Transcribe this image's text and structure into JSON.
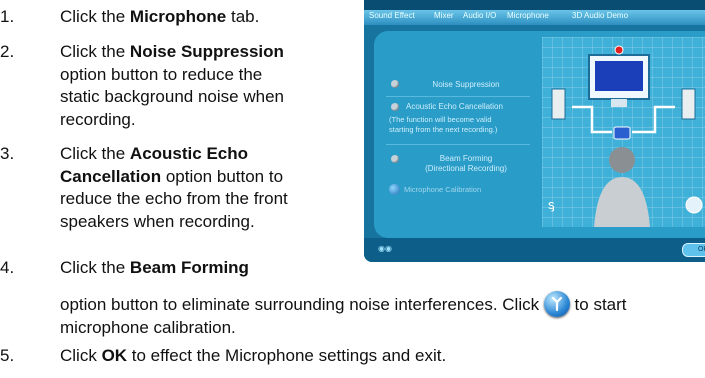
{
  "steps": [
    {
      "num": "1.",
      "pre": "Click the ",
      "bold": "Microphone",
      "post": " tab."
    },
    {
      "num": "2.",
      "pre": "Click the ",
      "bold": "Noise Suppression",
      "lines": [
        "option button to reduce the",
        "static background noise when",
        "recording."
      ]
    },
    {
      "num": "3.",
      "pre": "Click the ",
      "bold1": "Acoustic Echo",
      "bold2": "Cancellation",
      "post2": " option button to",
      "lines": [
        "reduce the echo from the front",
        "speakers when recording."
      ]
    },
    {
      "num": "4.",
      "pre": "Click the ",
      "bold": "Beam Forming",
      "line2_a": "option button to eliminate surrounding noise interferences. Click ",
      "line2_b": " to start",
      "line3": "microphone calibration."
    },
    {
      "num": "5.",
      "pre": "Click ",
      "bold": "OK",
      "post": " to effect the Microphone settings and exit."
    }
  ],
  "panel": {
    "tabs": [
      "Sound Effect",
      "Mixer",
      "Audio I/O",
      "Microphone",
      "3D Audio Demo"
    ],
    "options": {
      "noise": "Noise Suppression",
      "echo": "Acoustic Echo Cancellation",
      "echo_note_1": "(The function will become valid",
      "echo_note_2": "starting from the next recording.)",
      "beam_1": "Beam Forming",
      "beam_2": "(Directional Recording)",
      "calibration": "Microphone Calibration"
    },
    "ok_label": "OK"
  },
  "colors": {
    "panel_bg": "#16749e",
    "content_bg": "#2a9cc8",
    "diagram_bg": "#3fb0d8"
  }
}
